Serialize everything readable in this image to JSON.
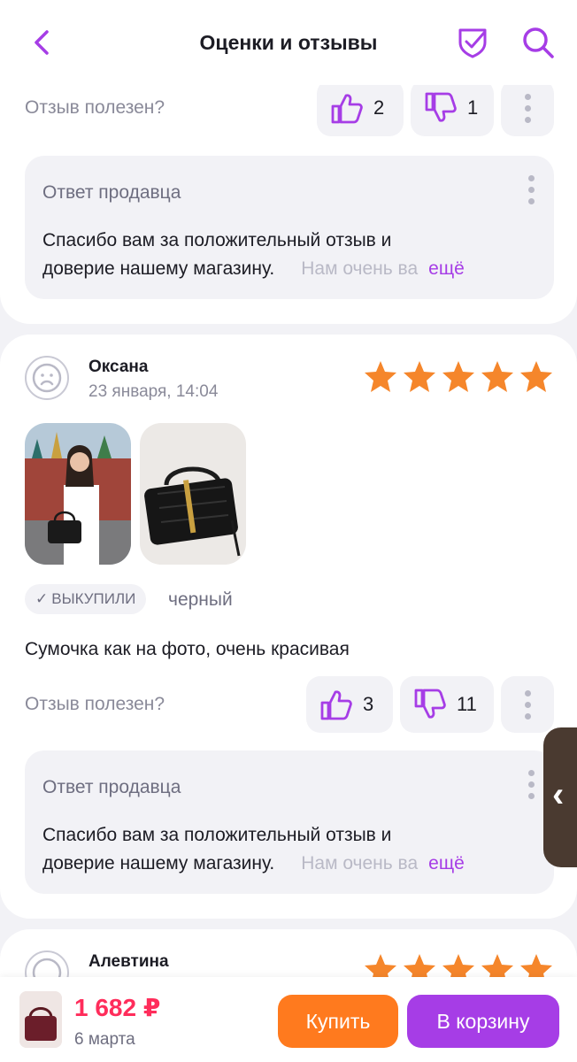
{
  "header": {
    "title": "Оценки и отзывы",
    "icons": [
      "back-icon",
      "shield-check-icon",
      "search-icon"
    ]
  },
  "review_prev": {
    "helpful_label": "Отзыв полезен?",
    "likes": "2",
    "dislikes": "1",
    "seller_answer": {
      "title": "Ответ продавца",
      "line1": "Спасибо вам за положительный отзыв и",
      "line2_main": "доверие нашему магазину.",
      "line2_fade": "Нам очень ва",
      "more": "ещё"
    }
  },
  "review_main": {
    "user_name": "Оксана",
    "date": "23 января, 14:04",
    "rating": 5,
    "badge": "ВЫКУПИЛИ",
    "badge_check": "✓",
    "color": "черный",
    "text": "Сумочка как на фото, очень красивая",
    "helpful_label": "Отзыв полезен?",
    "likes": "3",
    "dislikes": "11",
    "seller_answer": {
      "title": "Ответ продавца",
      "line1": "Спасибо вам за положительный отзыв и",
      "line2_main": "доверие нашему магазину.",
      "line2_fade": "Нам очень ва",
      "more": "ещё"
    }
  },
  "review_next": {
    "user_name": "Алевтина"
  },
  "side_tab": {
    "glyph": "‹"
  },
  "bottom_bar": {
    "price": "1 682 ₽",
    "delivery": "6 марта",
    "buy_label": "Купить",
    "cart_label": "В корзину"
  },
  "colors": {
    "accent": "#a63de6",
    "price": "#ff2d5b",
    "buy": "#ff7a1e",
    "star": "#f5862b"
  }
}
